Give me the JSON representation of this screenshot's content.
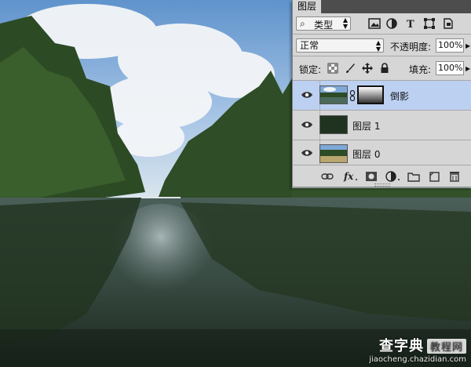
{
  "panel": {
    "tab_label": "图层",
    "filter": {
      "selected": "类型"
    },
    "blend_mode": "正常",
    "opacity": {
      "label": "不透明度:",
      "value": "100%"
    },
    "lock": {
      "label": "锁定:"
    },
    "fill": {
      "label": "填充:",
      "value": "100%"
    },
    "layers": [
      {
        "name": "倒影",
        "visible": true,
        "selected": true,
        "has_mask": true,
        "link_icon": "chain-icon"
      },
      {
        "name": "图层 1",
        "visible": true,
        "selected": false
      },
      {
        "name": "图层 0",
        "visible": true,
        "selected": false
      }
    ],
    "footer_icons": [
      "link-layers-icon",
      "fx-icon",
      "add-mask-icon",
      "adjustment-layer-icon",
      "new-group-icon",
      "new-layer-icon",
      "trash-icon"
    ]
  },
  "watermark": {
    "title": "查字典",
    "badge": "教程网",
    "url": "jiaocheng.chazidian.com"
  },
  "colors": {
    "panel_bg": "#d6d6d6",
    "selection": "#bcd0f2",
    "tabbar": "#4d4d4d"
  }
}
